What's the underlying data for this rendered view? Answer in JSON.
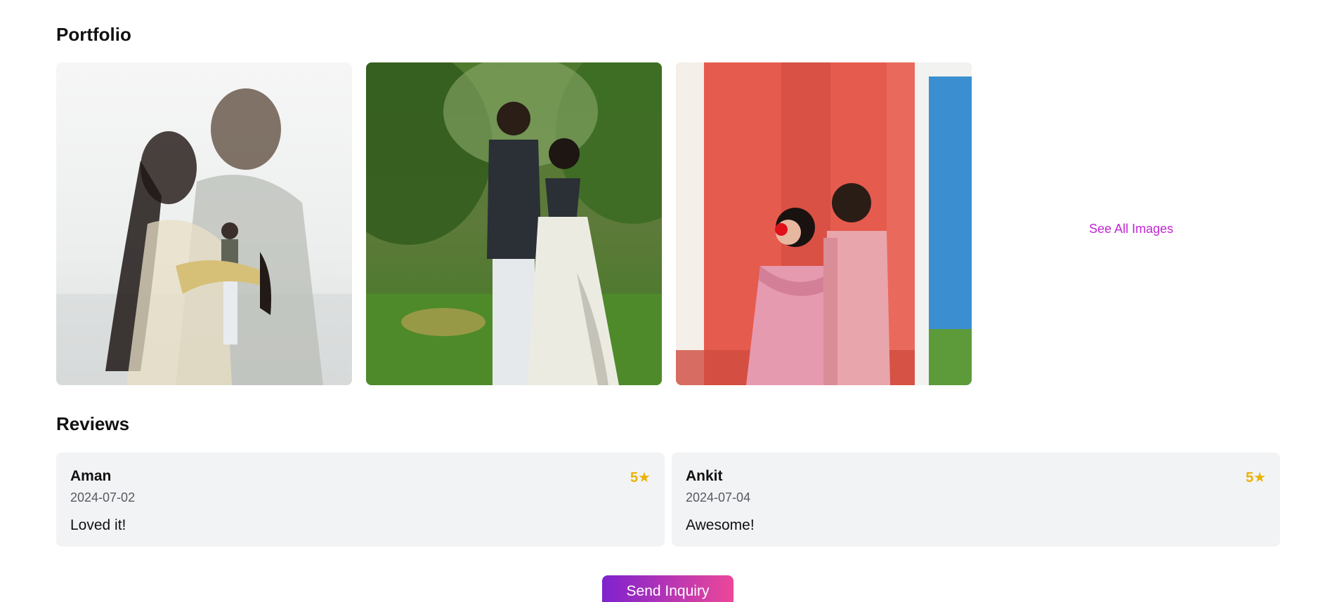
{
  "portfolio": {
    "title": "Portfolio",
    "images": [
      {
        "name": "couple-beach-double-exposure",
        "alt": "Couple portrait"
      },
      {
        "name": "couple-garden",
        "alt": "Couple in garden"
      },
      {
        "name": "couple-pink-wall",
        "alt": "Couple at red door"
      }
    ],
    "see_all_label": "See All Images"
  },
  "reviews": {
    "title": "Reviews",
    "items": [
      {
        "name": "Aman",
        "date": "2024-07-02",
        "text": "Loved it!",
        "rating": "5★"
      },
      {
        "name": "Ankit",
        "date": "2024-07-04",
        "text": "Awesome!",
        "rating": "5★"
      }
    ]
  },
  "actions": {
    "inquiry_label": "Send Inquiry"
  },
  "colors": {
    "accent": "#c026d3",
    "rating": "#eab308",
    "card_bg": "#f2f3f5",
    "button_gradient_start": "#7e22ce",
    "button_gradient_end": "#ec4899"
  }
}
